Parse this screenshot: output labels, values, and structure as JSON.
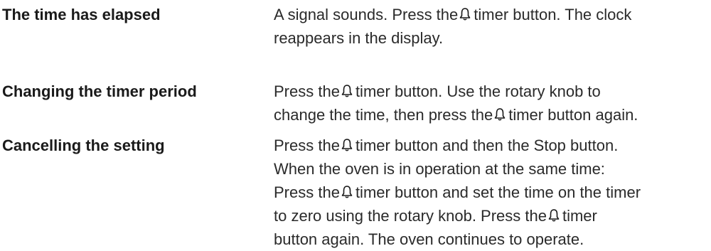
{
  "entries": [
    {
      "term": "The time has elapsed",
      "lines": [
        {
          "before": "A signal sounds. Press the",
          "icon": "bell-icon",
          "after": "timer button. The clock"
        },
        {
          "before": "reappears in the display."
        }
      ]
    },
    {
      "term": "Changing the timer period",
      "lines": [
        {
          "before": "Press the",
          "icon": "bell-icon",
          "after": "timer button. Use the rotary knob to"
        },
        {
          "before": "change the time, then press the",
          "icon": "bell-icon",
          "after": "timer button again."
        }
      ]
    },
    {
      "term": "Cancelling the setting",
      "lines": [
        {
          "before": "Press the",
          "icon": "bell-icon",
          "after": "timer button and then the Stop button."
        },
        {
          "before": "When the oven is in operation at the same time:"
        },
        {
          "before": "Press the",
          "icon": "bell-icon",
          "after": "timer button and set the time on the timer"
        },
        {
          "before": "to zero using the rotary knob. Press the",
          "icon": "bell-icon",
          "after": "timer"
        },
        {
          "before": "button again. The oven continues to operate."
        }
      ]
    }
  ]
}
